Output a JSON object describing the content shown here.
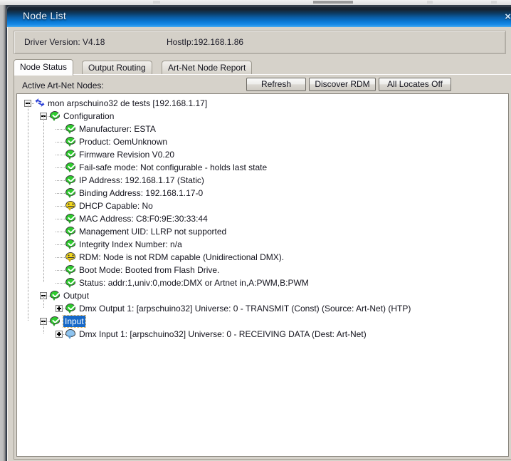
{
  "window": {
    "title": "Node List",
    "close_label": "×"
  },
  "header": {
    "driver_version": "Driver Version: V4.18",
    "host_ip": "HostIp:192.168.1.86"
  },
  "tabs": [
    {
      "label": "Node Status",
      "active": true
    },
    {
      "label": "Output Routing",
      "active": false
    },
    {
      "label": "Art-Net Node Report",
      "active": false
    }
  ],
  "toolbar": {
    "nodes_label": "Active Art-Net Nodes:",
    "refresh_label": "Refresh",
    "discover_rdm_label": "Discover RDM",
    "all_locates_off_label": "All Locates Off"
  },
  "colors": {
    "title_bar_start": "#1e2835",
    "title_bar_end": "#58b4f2",
    "selection": "#1668c8",
    "focus_outline": "#d8a13a",
    "icon_ok": "#2ecb2e",
    "icon_warn": "#f2d61e",
    "icon_input": "#8fc4ef",
    "dialog_face": "#d6d2ca"
  },
  "tree": {
    "nodes": [
      {
        "id": "root",
        "depth": 0,
        "icon": "network-arrows-icon",
        "expander": "minus",
        "label": "mon arpschuino32 de tests [192.168.1.17]",
        "selected": false
      },
      {
        "id": "config",
        "depth": 1,
        "icon": "bubble-green-check-icon",
        "expander": "minus",
        "label": "Configuration",
        "selected": false
      },
      {
        "id": "manufacturer",
        "depth": 2,
        "icon": "bubble-green-check-icon",
        "expander": "none",
        "label": "Manufacturer: ESTA",
        "selected": false
      },
      {
        "id": "product",
        "depth": 2,
        "icon": "bubble-green-check-icon",
        "expander": "none",
        "label": "Product: OemUnknown",
        "selected": false
      },
      {
        "id": "firmware",
        "depth": 2,
        "icon": "bubble-green-check-icon",
        "expander": "none",
        "label": "Firmware Revision V0.20",
        "selected": false
      },
      {
        "id": "failsafe",
        "depth": 2,
        "icon": "bubble-green-check-icon",
        "expander": "none",
        "label": "Fail-safe mode: Not configurable - holds last state",
        "selected": false
      },
      {
        "id": "ipaddr",
        "depth": 2,
        "icon": "bubble-green-check-icon",
        "expander": "none",
        "label": "IP Address: 192.168.1.17 (Static)",
        "selected": false
      },
      {
        "id": "binding",
        "depth": 2,
        "icon": "bubble-green-check-icon",
        "expander": "none",
        "label": "Binding Address: 192.168.1.17-0",
        "selected": false
      },
      {
        "id": "dhcp",
        "depth": 2,
        "icon": "bubble-yellow-face-icon",
        "expander": "none",
        "label": "DHCP Capable: No",
        "selected": false
      },
      {
        "id": "mac",
        "depth": 2,
        "icon": "bubble-green-check-icon",
        "expander": "none",
        "label": "MAC Address: C8:F0:9E:30:33:44",
        "selected": false
      },
      {
        "id": "mgmtuid",
        "depth": 2,
        "icon": "bubble-green-check-icon",
        "expander": "none",
        "label": "Management UID: LLRP not supported",
        "selected": false
      },
      {
        "id": "integrity",
        "depth": 2,
        "icon": "bubble-green-check-icon",
        "expander": "none",
        "label": "Integrity Index Number: n/a",
        "selected": false
      },
      {
        "id": "rdm",
        "depth": 2,
        "icon": "bubble-yellow-face-icon",
        "expander": "none",
        "label": "RDM: Node is not RDM capable (Unidirectional DMX).",
        "selected": false
      },
      {
        "id": "bootmode",
        "depth": 2,
        "icon": "bubble-green-check-icon",
        "expander": "none",
        "label": "Boot Mode: Booted from Flash Drive.",
        "selected": false
      },
      {
        "id": "status",
        "depth": 2,
        "icon": "bubble-green-check-icon",
        "expander": "none",
        "label": "Status: addr:1,univ:0,mode:DMX or Artnet in,A:PWM,B:PWM",
        "selected": false
      },
      {
        "id": "output",
        "depth": 1,
        "icon": "bubble-green-check-icon",
        "expander": "minus",
        "label": "Output",
        "selected": false
      },
      {
        "id": "dmxout1",
        "depth": 2,
        "icon": "bubble-green-check-icon",
        "expander": "plus",
        "label": "Dmx Output 1: [arpschuino32] Universe: 0  - TRANSMIT   (Const) (Source: Art-Net) (HTP)",
        "selected": false
      },
      {
        "id": "input",
        "depth": 1,
        "icon": "bubble-green-check-icon",
        "expander": "minus",
        "label": "Input",
        "selected": true
      },
      {
        "id": "dmxin1",
        "depth": 2,
        "icon": "bubble-blue-icon",
        "expander": "plus",
        "label": "Dmx Input 1: [arpschuino32] Universe: 0 - RECEIVING DATA (Dest: Art-Net)",
        "selected": false
      }
    ]
  }
}
